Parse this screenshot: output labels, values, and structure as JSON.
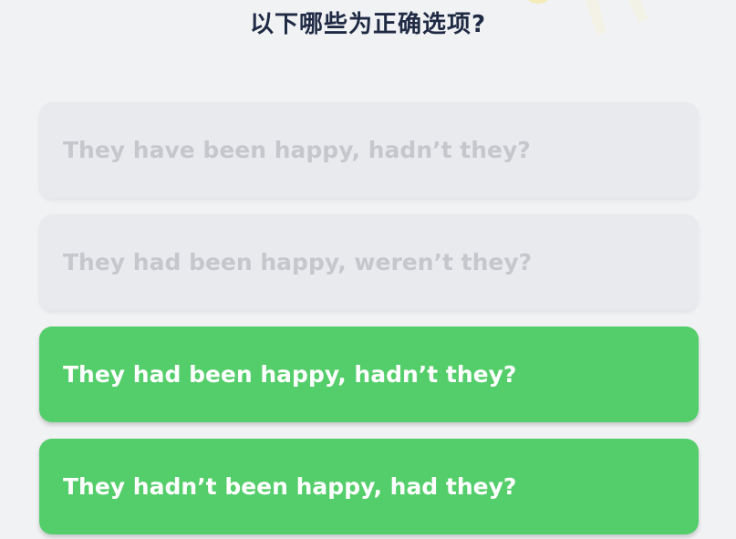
{
  "quiz": {
    "question": "以下哪些为正确选项?",
    "options": [
      {
        "label": "They have been happy, hadn’t they?",
        "state": "disabled"
      },
      {
        "label": "They had been happy, weren’t they?",
        "state": "disabled"
      },
      {
        "label": "They had been happy, hadn’t they?",
        "state": "correct"
      },
      {
        "label": "They hadn’t been happy, had they?",
        "state": "correct"
      }
    ]
  },
  "colors": {
    "background": "#f1f2f4",
    "title": "#1f2a44",
    "option_disabled_bg": "#e9eaee",
    "option_disabled_text": "#c6c7cc",
    "option_correct_bg": "#54ce6a",
    "option_correct_text": "#ffffff"
  },
  "icons": {
    "decoration": "celebration-sparkle-icon"
  }
}
